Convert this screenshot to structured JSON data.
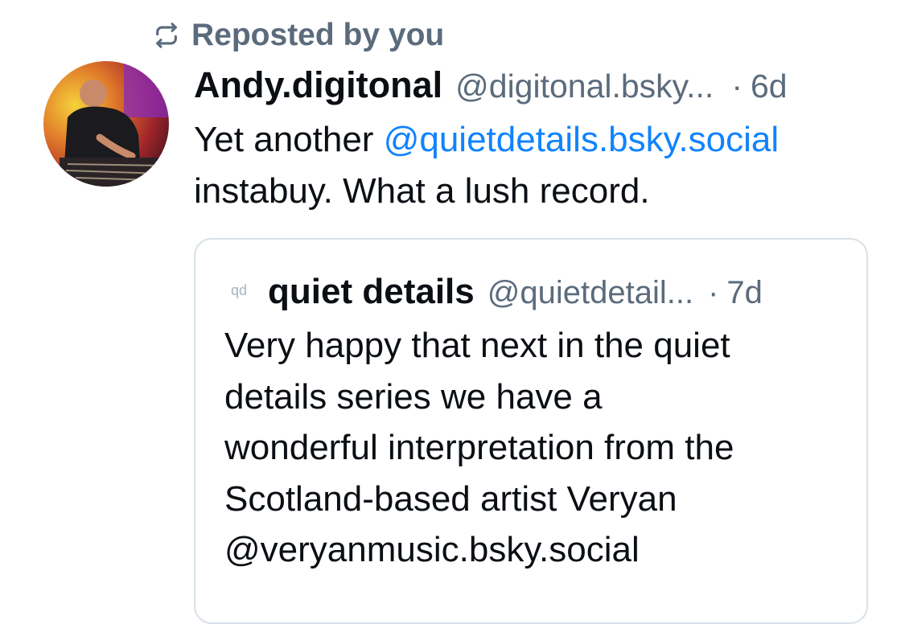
{
  "repost": {
    "icon": "repost-icon",
    "label": "Reposted by you"
  },
  "post": {
    "author_name": "Andy.digitonal",
    "author_handle": "@digitonal.bsky...",
    "separator": "·",
    "time": "6d",
    "text_before": "Yet another ",
    "mention": "@quietdetails.bsky.social",
    "text_after": "instabuy. What a lush record."
  },
  "quote": {
    "avatar_text": "qd",
    "author_name": "quiet details",
    "author_handle": "@quietdetail...",
    "separator": "·",
    "time": "7d",
    "lines": [
      "Very happy that next in the quiet",
      "details series we have a",
      "wonderful interpretation from the",
      "Scotland-based artist Veryan",
      "@veryanmusic.bsky.social"
    ]
  },
  "colors": {
    "text_primary": "#0b0f14",
    "text_secondary": "#5b6b7c",
    "link": "#1083fe",
    "card_border": "#d8e1e8"
  }
}
